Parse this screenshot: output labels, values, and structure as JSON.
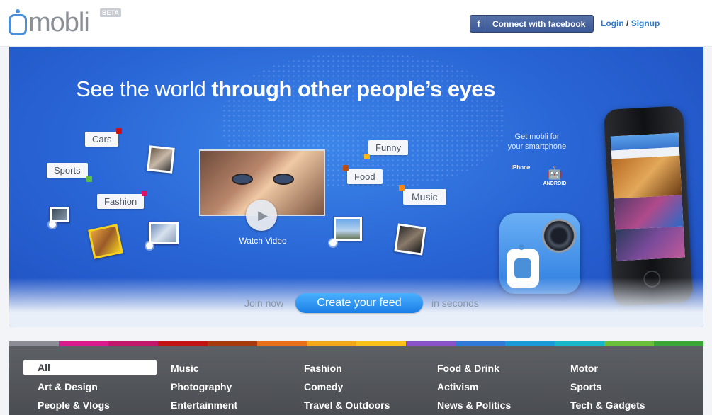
{
  "header": {
    "logo_text": "mobli",
    "beta": "BETA",
    "facebook_icon": "f",
    "facebook_label": "Connect with facebook",
    "login": "Login",
    "login_sep": "/",
    "signup": "Signup"
  },
  "hero": {
    "headline_light": "See the world",
    "headline_bold": "through other people’s eyes",
    "tags": {
      "cars": "Cars",
      "sports": "Sports",
      "fashion": "Fashion",
      "funny": "Funny",
      "food": "Food",
      "music": "Music"
    },
    "tag_colors": {
      "cars": "#cc1111",
      "sports": "#5cbf3a",
      "fashion": "#d8116a",
      "funny": "#f2b81a",
      "food": "#b84a12",
      "music": "#f08a12"
    },
    "play_icon": "▶",
    "watch_video": "Watch Video",
    "get_mobli_line1": "Get mobli for",
    "get_mobli_line2": "your smartphone",
    "iphone_glyph": "",
    "iphone_label": "iPhone",
    "android_glyph": "🤖",
    "android_label": "ANDROID",
    "join_now": "Join now",
    "create_feed": "Create your feed",
    "in_seconds": "in seconds"
  },
  "categories": {
    "stripe_colors": [
      "#8a8e94",
      "#d81b8c",
      "#c2186b",
      "#c01515",
      "#a83a12",
      "#e8701a",
      "#f2a81a",
      "#f7c21a",
      "#8a52c8",
      "#2f7ad6",
      "#1a9ad6",
      "#19b8c8",
      "#6abf3a",
      "#3aa63a"
    ],
    "col1": [
      "All",
      "Art & Design",
      "People & Vlogs"
    ],
    "col2": [
      "Music",
      "Photography",
      "Entertainment"
    ],
    "col3": [
      "Fashion",
      "Comedy",
      "Travel & Outdoors"
    ],
    "col4": [
      "Food & Drink",
      "Activism",
      "News & Politics"
    ],
    "col5": [
      "Motor",
      "Sports",
      "Tech & Gadgets"
    ]
  }
}
